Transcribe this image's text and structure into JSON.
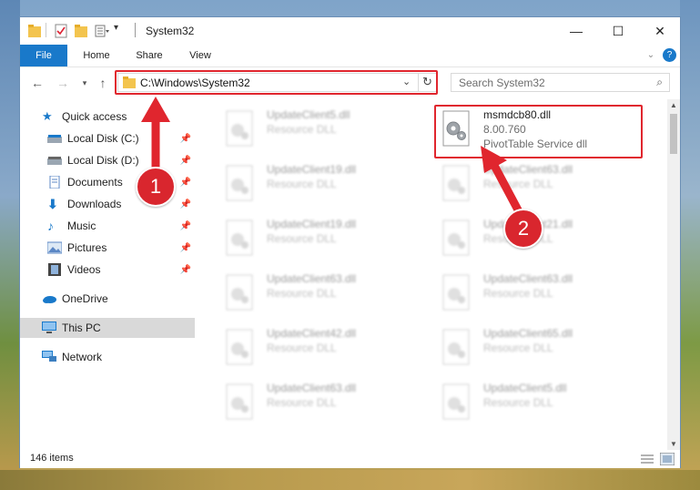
{
  "window": {
    "title": "System32",
    "minimize": "—",
    "maximize": "☐",
    "close": "✕"
  },
  "ribbon": {
    "tabs": [
      "File",
      "Home",
      "Share",
      "View"
    ],
    "help": "?"
  },
  "nav": {
    "address": "C:\\Windows\\System32",
    "search_placeholder": "Search System32"
  },
  "sidebar": {
    "items": [
      {
        "label": "Quick access",
        "icon": "star-icon",
        "pinned": false
      },
      {
        "label": "Local Disk (C:)",
        "icon": "drive-icon",
        "pinned": true
      },
      {
        "label": "Local Disk (D:)",
        "icon": "drive-icon",
        "pinned": true
      },
      {
        "label": "Documents",
        "icon": "documents-icon",
        "pinned": true
      },
      {
        "label": "Downloads",
        "icon": "download-icon",
        "pinned": true
      },
      {
        "label": "Music",
        "icon": "music-icon",
        "pinned": true
      },
      {
        "label": "Pictures",
        "icon": "pictures-icon",
        "pinned": true
      },
      {
        "label": "Videos",
        "icon": "videos-icon",
        "pinned": true
      },
      {
        "label": "OneDrive",
        "icon": "cloud-icon",
        "pinned": false
      },
      {
        "label": "This PC",
        "icon": "computer-icon",
        "pinned": false
      },
      {
        "label": "Network",
        "icon": "network-icon",
        "pinned": false
      }
    ]
  },
  "files": {
    "left": [
      {
        "name": "UpdateClient5.dll",
        "desc": "Resource DLL"
      },
      {
        "name": "UpdateClient19.dll",
        "desc": "Resource DLL"
      },
      {
        "name": "UpdateClient19.dll",
        "desc": "Resource DLL"
      },
      {
        "name": "UpdateClient63.dll",
        "desc": "Resource DLL"
      },
      {
        "name": "UpdateClient42.dll",
        "desc": "Resource DLL"
      },
      {
        "name": "UpdateClient63.dll",
        "desc": "Resource DLL"
      }
    ],
    "right": [
      {
        "name": "msmdcb80.dll",
        "desc": "8.00.760",
        "desc2": "PivotTable Service dll"
      },
      {
        "name": "UpdateClient63.dll",
        "desc": "Resource DLL"
      },
      {
        "name": "UpdateClient21.dll",
        "desc": "Resource DLL"
      },
      {
        "name": "UpdateClient63.dll",
        "desc": "Resource DLL"
      },
      {
        "name": "UpdateClient65.dll",
        "desc": "Resource DLL"
      },
      {
        "name": "UpdateClient5.dll",
        "desc": "Resource DLL"
      }
    ]
  },
  "status": {
    "item_count": "146 items"
  },
  "callouts": [
    "1",
    "2"
  ],
  "colors": {
    "highlight_red": "#e0262e",
    "file_tab_blue": "#1979ca",
    "selection_blue": "#cce8ff"
  }
}
